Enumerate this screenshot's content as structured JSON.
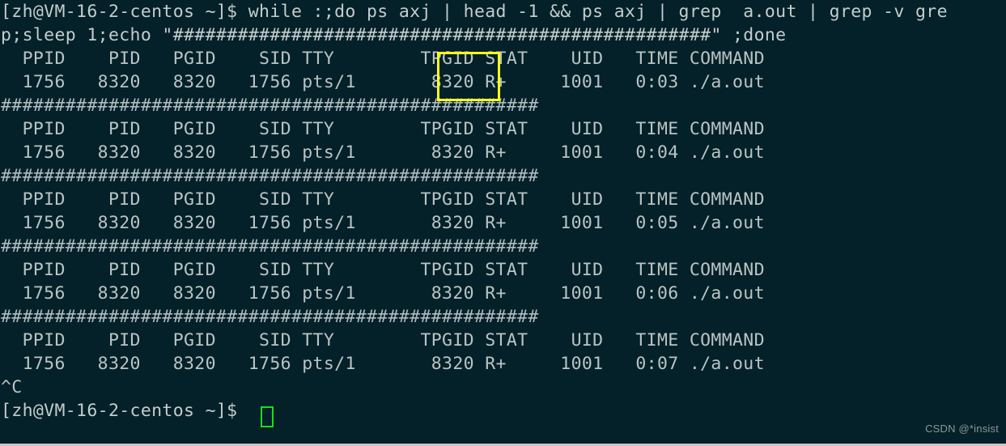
{
  "terminal": {
    "background_color": "#042028",
    "foreground_color": "#b9c4c4",
    "cursor_color": "#19e019",
    "highlight_color": "#ffff19",
    "prompt": "[zh@VM-16-2-centos ~]$ ",
    "separator": "##################################################",
    "lines": [
      {
        "name": "command-line-1",
        "kind": "cmd",
        "text": "[zh@VM-16-2-centos ~]$ while :;do ps axj | head -1 && ps axj | grep  a.out | grep -v gre"
      },
      {
        "name": "command-line-2",
        "kind": "cmd",
        "text": "p;sleep 1;echo \"##################################################\" ;done"
      },
      {
        "name": "ps-header-1",
        "kind": "out",
        "text": "  PPID    PID   PGID    SID TTY        TPGID STAT    UID   TIME COMMAND"
      },
      {
        "name": "ps-row-1",
        "kind": "out",
        "text": "  1756   8320   8320   1756 pts/1       8320 R+     1001   0:03 ./a.out"
      },
      {
        "name": "separator-1",
        "kind": "hash",
        "text": "##################################################"
      },
      {
        "name": "ps-header-2",
        "kind": "out",
        "text": "  PPID    PID   PGID    SID TTY        TPGID STAT    UID   TIME COMMAND"
      },
      {
        "name": "ps-row-2",
        "kind": "out",
        "text": "  1756   8320   8320   1756 pts/1       8320 R+     1001   0:04 ./a.out"
      },
      {
        "name": "separator-2",
        "kind": "hash",
        "text": "##################################################"
      },
      {
        "name": "ps-header-3",
        "kind": "out",
        "text": "  PPID    PID   PGID    SID TTY        TPGID STAT    UID   TIME COMMAND"
      },
      {
        "name": "ps-row-3",
        "kind": "out",
        "text": "  1756   8320   8320   1756 pts/1       8320 R+     1001   0:05 ./a.out"
      },
      {
        "name": "separator-3",
        "kind": "hash",
        "text": "##################################################"
      },
      {
        "name": "ps-header-4",
        "kind": "out",
        "text": "  PPID    PID   PGID    SID TTY        TPGID STAT    UID   TIME COMMAND"
      },
      {
        "name": "ps-row-4",
        "kind": "out",
        "text": "  1756   8320   8320   1756 pts/1       8320 R+     1001   0:06 ./a.out"
      },
      {
        "name": "separator-4",
        "kind": "hash",
        "text": "##################################################"
      },
      {
        "name": "ps-header-5",
        "kind": "out",
        "text": "  PPID    PID   PGID    SID TTY        TPGID STAT    UID   TIME COMMAND"
      },
      {
        "name": "ps-row-5",
        "kind": "out",
        "text": "  1756   8320   8320   1756 pts/1       8320 R+     1001   0:07 ./a.out"
      },
      {
        "name": "interrupt-line",
        "kind": "out",
        "text": "^C"
      },
      {
        "name": "final-prompt",
        "kind": "prompt",
        "text": "[zh@VM-16-2-centos ~]$ "
      }
    ],
    "ps_columns": [
      "PPID",
      "PID",
      "PGID",
      "SID",
      "TTY",
      "TPGID",
      "STAT",
      "UID",
      "TIME",
      "COMMAND"
    ],
    "ps_sample_row": {
      "PPID": "1756",
      "PID": "8320",
      "PGID": "8320",
      "SID": "1756",
      "TTY": "pts/1",
      "TPGID": "8320",
      "STAT": "R+",
      "UID": "1001",
      "TIME": "0:03",
      "COMMAND": "./a.out"
    },
    "time_values": [
      "0:03",
      "0:04",
      "0:05",
      "0:06",
      "0:07"
    ],
    "highlight_label": "STAT"
  },
  "watermark": {
    "text": "CSDN @*insist"
  }
}
